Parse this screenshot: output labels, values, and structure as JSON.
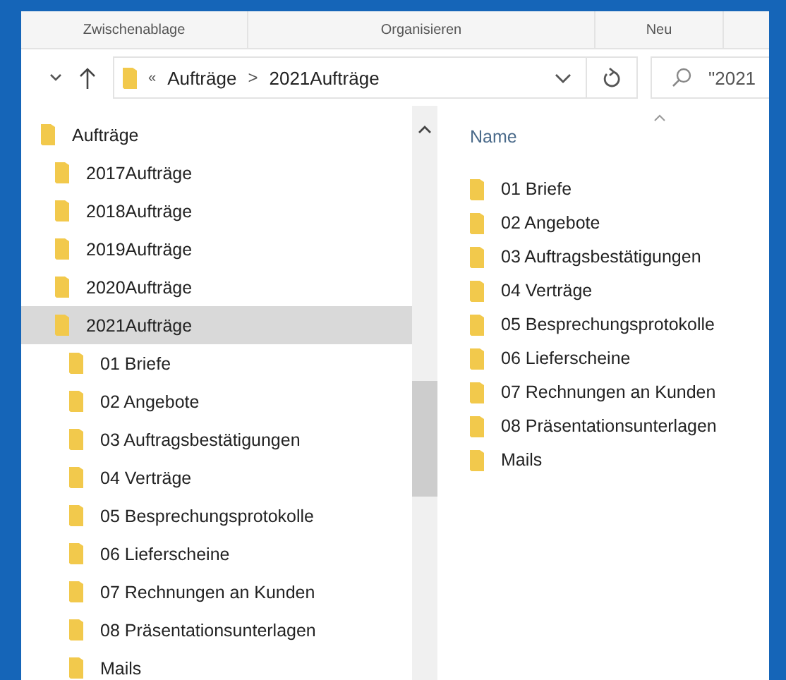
{
  "ribbon_groups": [
    "Zwischenablage",
    "Organisieren",
    "Neu"
  ],
  "address_bar": {
    "overflow": "«",
    "path": [
      "Aufträge",
      "2021Aufträge"
    ],
    "separator": ">"
  },
  "search": {
    "value": "\"2021"
  },
  "navigation": {
    "tree": [
      {
        "label": "Aufträge",
        "selected": false,
        "children": [
          {
            "label": "2017Aufträge",
            "selected": false
          },
          {
            "label": "2018Aufträge",
            "selected": false
          },
          {
            "label": "2019Aufträge",
            "selected": false
          },
          {
            "label": "2020Aufträge",
            "selected": false
          },
          {
            "label": "2021Aufträge",
            "selected": true,
            "children": [
              {
                "label": "01 Briefe",
                "selected": false
              },
              {
                "label": "02 Angebote",
                "selected": false
              },
              {
                "label": "03 Auftragsbestätigungen",
                "selected": false
              },
              {
                "label": "04 Verträge",
                "selected": false
              },
              {
                "label": "05 Besprechungsprotokolle",
                "selected": false
              },
              {
                "label": "06 Lieferscheine",
                "selected": false
              },
              {
                "label": "07 Rechnungen an Kunden",
                "selected": false
              },
              {
                "label": "08 Präsentationsunterlagen",
                "selected": false
              },
              {
                "label": "Mails",
                "selected": false
              }
            ]
          }
        ]
      }
    ]
  },
  "content": {
    "column": "Name",
    "items": [
      "01 Briefe",
      "02 Angebote",
      "03 Auftragsbestätigungen",
      "04 Verträge",
      "05 Besprechungsprotokolle",
      "06 Lieferscheine",
      "07 Rechnungen an Kunden",
      "08 Präsentationsunterlagen",
      "Mails"
    ]
  }
}
